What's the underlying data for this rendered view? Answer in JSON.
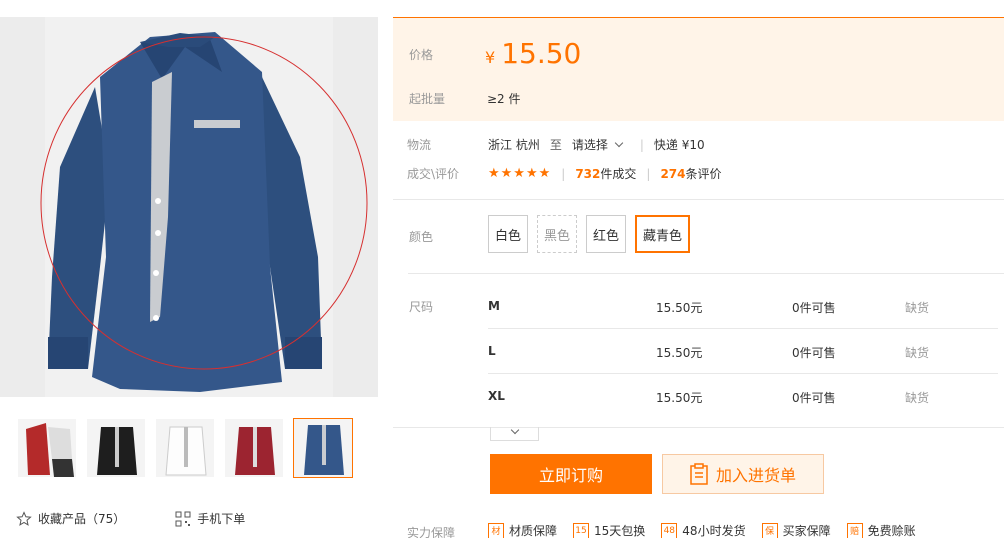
{
  "price": {
    "label": "价格",
    "currency": "¥",
    "value": "15.50"
  },
  "moq": {
    "label": "起批量",
    "value": "≥2 件"
  },
  "logistics": {
    "label": "物流",
    "origin": "浙江 杭州",
    "to": "至",
    "destination": "请选择",
    "shipping": "快递 ¥10"
  },
  "deals": {
    "label": "成交\\评价",
    "stars": "★★★★★",
    "orders_count": "732",
    "orders_unit": "件成交",
    "reviews_count": "274",
    "reviews_unit": "条评价"
  },
  "colors": {
    "label": "颜色",
    "options": [
      "白色",
      "黑色",
      "红色",
      "藏青色"
    ],
    "selected": "藏青色"
  },
  "sizes": {
    "label": "尺码",
    "rows": [
      {
        "size": "M",
        "price": "15.50元",
        "stock": "0件可售",
        "status": "缺货"
      },
      {
        "size": "L",
        "price": "15.50元",
        "stock": "0件可售",
        "status": "缺货"
      },
      {
        "size": "XL",
        "price": "15.50元",
        "stock": "0件可售",
        "status": "缺货"
      }
    ]
  },
  "actions": {
    "buy": "立即订购",
    "cart": "加入进货单"
  },
  "guarantee": {
    "label": "实力保障",
    "items": [
      {
        "icon": "材",
        "text": "材质保障"
      },
      {
        "icon": "15",
        "text": "15天包换"
      },
      {
        "icon": "48",
        "text": "48小时发货"
      },
      {
        "icon": "保",
        "text": "买家保障"
      },
      {
        "icon": "赔",
        "text": "免费赊账"
      }
    ]
  },
  "gallery": {
    "thumbnails": [
      "red-shirt",
      "black-shirt",
      "white-shirt",
      "burgundy-shirt",
      "navy-shirt"
    ],
    "selected_index": 4
  },
  "links": {
    "favorite": "收藏产品（75）",
    "mobile": "手机下单"
  },
  "colors_theme": {
    "accent": "#ff7300",
    "price_bg": "#fff4e8"
  }
}
